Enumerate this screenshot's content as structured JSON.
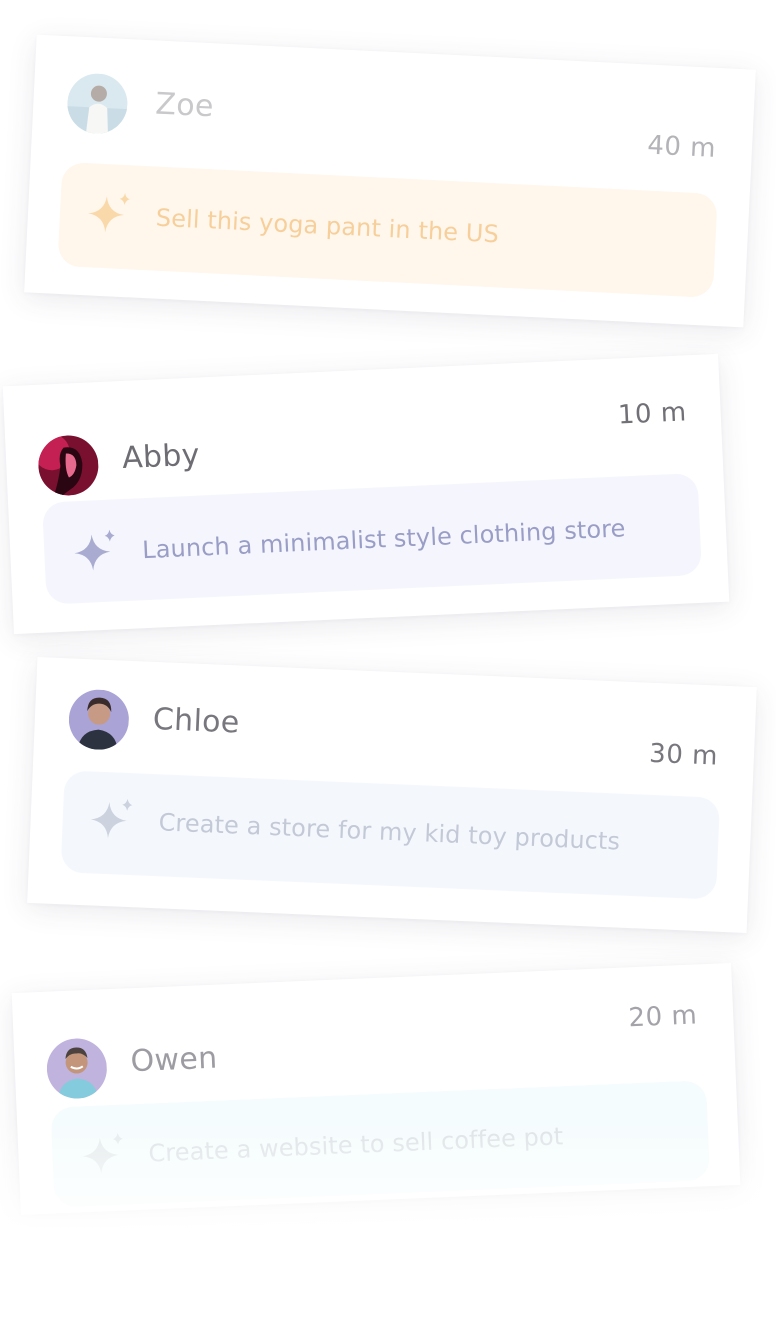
{
  "cards": [
    {
      "name": "Zoe",
      "time": "40 m",
      "prompt": "Sell this yoga pant in the US",
      "avatar_icon": "avatar-photo-woman",
      "accent": "#f6cf9a",
      "prompt_bg": "#fff6ec"
    },
    {
      "name": "Abby",
      "time": "10 m",
      "prompt": "Launch a minimalist style clothing store",
      "avatar_icon": "avatar-photo-woman",
      "accent": "#9a9ec6",
      "prompt_bg": "#f5f6fd"
    },
    {
      "name": "Chloe",
      "time": "30 m",
      "prompt": "Create a store for my kid toy products",
      "avatar_icon": "avatar-photo-woman",
      "accent": "#c3c9d6",
      "prompt_bg": "#f4f8fd"
    },
    {
      "name": "Owen",
      "time": "20 m",
      "prompt": "Create a website to sell coffee pot",
      "avatar_icon": "avatar-photo-man",
      "accent": "#dde2e6",
      "prompt_bg": "#f5fcfd"
    }
  ],
  "icons": {
    "prompt_icon": "sparkle-icon"
  }
}
